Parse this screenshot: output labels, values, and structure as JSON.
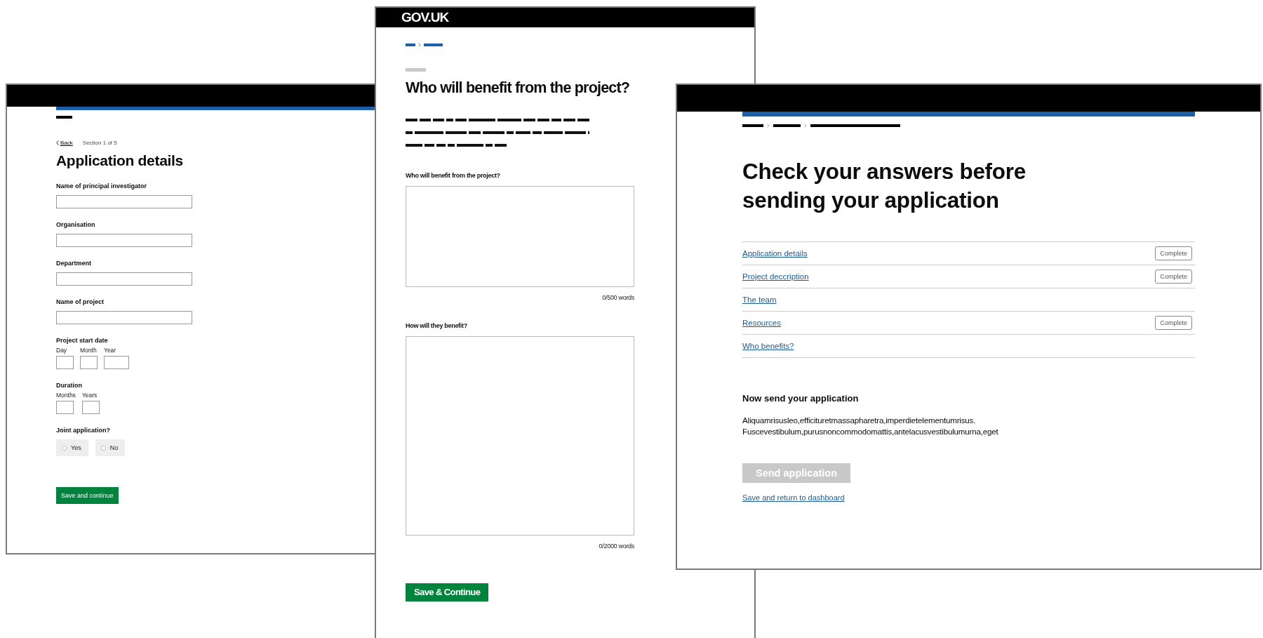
{
  "application_details_page": {
    "back_link": "Back",
    "section": "Section 1 of 5",
    "title": "Application details",
    "text_fields": [
      {
        "label": "Name of principal investigator"
      },
      {
        "label": "Organisation"
      },
      {
        "label": "Department"
      },
      {
        "label": "Name of project"
      }
    ],
    "start_date": {
      "label": "Project start date",
      "parts": [
        {
          "label": "Day",
          "kind": "short"
        },
        {
          "label": "Month",
          "kind": "short"
        },
        {
          "label": "Year",
          "kind": "long"
        }
      ]
    },
    "duration": {
      "label": "Duration",
      "parts": [
        {
          "label": "Months",
          "kind": "short"
        },
        {
          "label": "Years",
          "kind": "short"
        }
      ]
    },
    "joint_application": {
      "label": "Joint application?",
      "options": [
        {
          "label": "Yes",
          "selected": false
        },
        {
          "label": "No",
          "selected": false
        }
      ]
    },
    "button": "Save and continue"
  },
  "benefit_page": {
    "logo": "GOV.UK",
    "title": "Who will benefit from the project?",
    "questions": [
      {
        "label": "Who will benefit from the project?",
        "counter": "0/500 words",
        "kind": "short"
      },
      {
        "label": "How will they benefit?",
        "counter": "0/2000 words",
        "kind": "long"
      }
    ],
    "button": "Save & Continue"
  },
  "check_answers_page": {
    "title": "Check your answers before sending your application",
    "sections": [
      {
        "label": "Application details",
        "status": "Complete"
      },
      {
        "label": "Project deccription",
        "status": "Complete"
      },
      {
        "label": "The team"
      },
      {
        "label": "Resources",
        "status": "Complete"
      },
      {
        "label": "Who benefits?"
      }
    ],
    "send_heading": "Now send your application",
    "body": "Aliquamrisusleo,efficituretmassapharetra,imperdietelementumrisus. Fuscevestibulum,purusnoncommodomattis,antelacusvestibulumurna,eget",
    "send_button": {
      "label": "Send application",
      "disabled": true
    },
    "return_link": "Save and return to dashboard"
  }
}
